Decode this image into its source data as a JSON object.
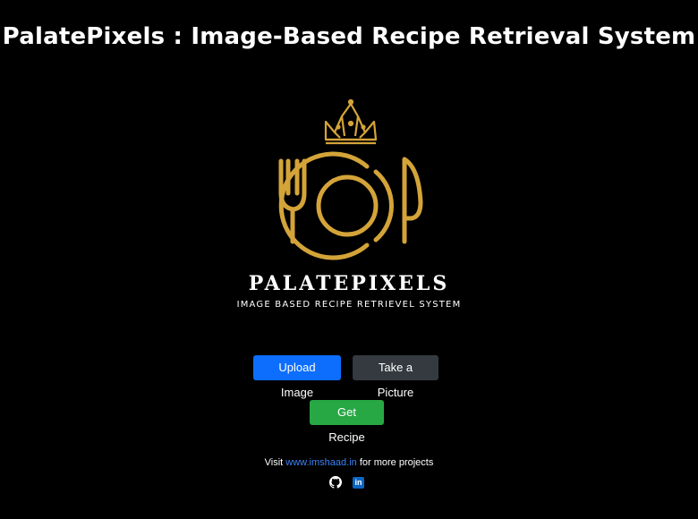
{
  "app": {
    "title": "PalatePixels : Image-Based Recipe Retrieval System"
  },
  "logo": {
    "name": "PALATEPIXELS",
    "tagline": "IMAGE BASED RECIPE RETRIEVEL SYSTEM",
    "accent_color": "#d4a439",
    "icons": [
      "crown-icon",
      "fork-icon",
      "plate-icon",
      "knife-icon"
    ]
  },
  "actions": {
    "upload_label": "Upload Image",
    "camera_label": "Take a Picture",
    "recipe_label": "Get Recipe"
  },
  "colors": {
    "upload": "#0d6efd",
    "camera": "#343a40",
    "recipe": "#28a745",
    "link": "#3b82f6"
  },
  "footer": {
    "prefix": "Visit ",
    "link_text": "www.imshaad.in",
    "suffix": " for more projects",
    "icons": [
      "github-icon",
      "linkedin-icon"
    ],
    "linkedin_glyph": "in"
  }
}
